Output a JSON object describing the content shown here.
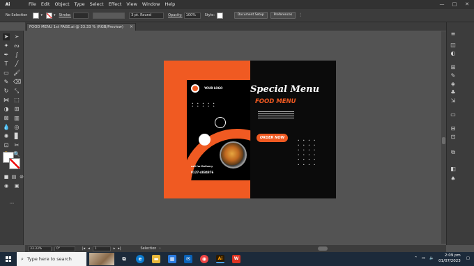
{
  "app": {
    "logo": "Ai"
  },
  "menu": [
    "File",
    "Edit",
    "Object",
    "Type",
    "Select",
    "Effect",
    "View",
    "Window",
    "Help"
  ],
  "control": {
    "selection": "No Selection",
    "stroke_label": "Stroke:",
    "brush": "3 pt. Round",
    "opacity_label": "Opacity:",
    "opacity_value": "100%",
    "style_label": "Style:",
    "doc_setup": "Document Setup",
    "preferences": "Preferences"
  },
  "tab": {
    "title": "FOOD MENU 1st PAGE.ai @ 33.33 % (RGB/Preview)",
    "close": "×"
  },
  "artwork": {
    "logo_text": "YOUR LOGO",
    "title_script": "Special Menu",
    "title_bold": "FOOD MENU",
    "order_button": "ORDER NOW",
    "delivery": "call for Delivery",
    "phone": "0127-4834876",
    "accent": "#f05a22"
  },
  "status": {
    "zoom": "33.33%",
    "angle": "0°",
    "artboard": "1",
    "tool": "Selection"
  },
  "taskbar": {
    "search_placeholder": "Type here to search",
    "time": "2:09 pm",
    "date": "01/07/2023"
  }
}
